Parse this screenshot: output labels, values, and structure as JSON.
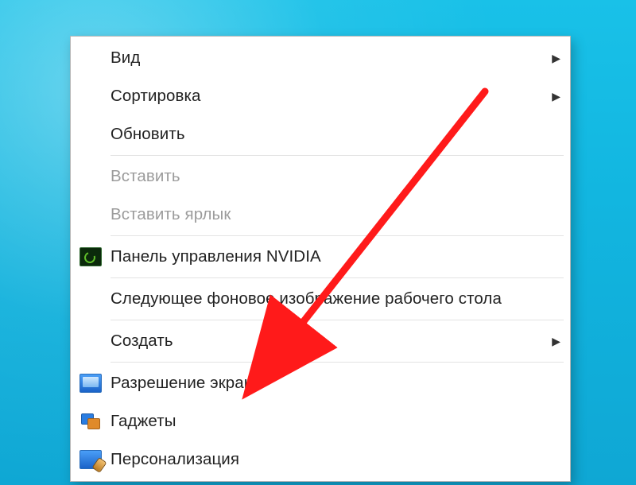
{
  "menu": {
    "items": [
      {
        "id": "view",
        "label": "Вид",
        "icon": null,
        "submenu": true,
        "disabled": false
      },
      {
        "id": "sort",
        "label": "Сортировка",
        "icon": null,
        "submenu": true,
        "disabled": false
      },
      {
        "id": "refresh",
        "label": "Обновить",
        "icon": null,
        "submenu": false,
        "disabled": false
      },
      {
        "sep": true
      },
      {
        "id": "paste",
        "label": "Вставить",
        "icon": null,
        "submenu": false,
        "disabled": true
      },
      {
        "id": "paste-short",
        "label": "Вставить ярлык",
        "icon": null,
        "submenu": false,
        "disabled": true
      },
      {
        "sep": true
      },
      {
        "id": "nvidia",
        "label": "Панель управления NVIDIA",
        "icon": "nvidia",
        "submenu": false,
        "disabled": false
      },
      {
        "sep": true
      },
      {
        "id": "next-bg",
        "label": "Следующее фоновое изображение рабочего стола",
        "icon": null,
        "submenu": false,
        "disabled": false
      },
      {
        "sep": true
      },
      {
        "id": "new",
        "label": "Создать",
        "icon": null,
        "submenu": true,
        "disabled": false
      },
      {
        "sep": true
      },
      {
        "id": "resolution",
        "label": "Разрешение экрана",
        "icon": "resolution",
        "submenu": false,
        "disabled": false
      },
      {
        "id": "gadgets",
        "label": "Гаджеты",
        "icon": "gadgets",
        "submenu": false,
        "disabled": false
      },
      {
        "id": "personalize",
        "label": "Персонализация",
        "icon": "personalize",
        "submenu": false,
        "disabled": false
      }
    ]
  },
  "annotation": {
    "arrow_color": "#ff1a1a",
    "target_item_id": "resolution"
  }
}
